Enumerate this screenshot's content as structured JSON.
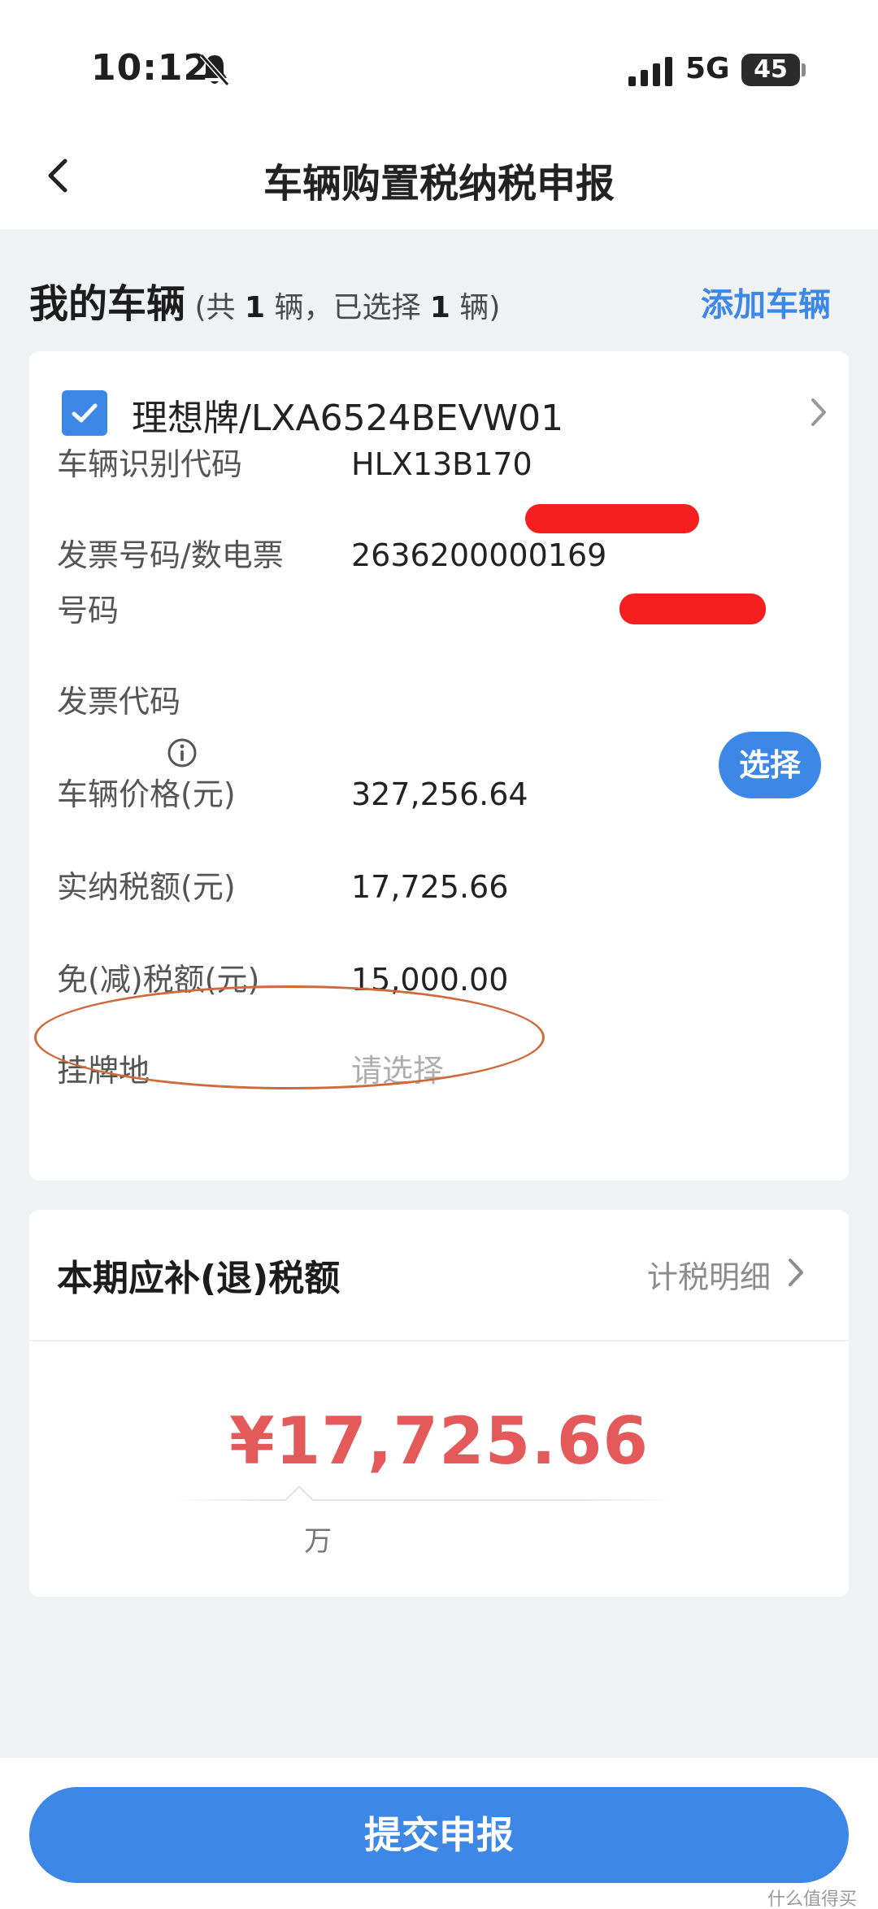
{
  "status_bar": {
    "time": "10:12",
    "network": "5G",
    "battery": "45"
  },
  "nav": {
    "title": "车辆购置税纳税申报"
  },
  "section": {
    "title": "我的车辆",
    "subtitle_pre": " (共 ",
    "total_count": "1",
    "subtitle_mid": " 辆，已选择 ",
    "selected_count": "1",
    "subtitle_post": " 辆)",
    "add_link": "添加车辆"
  },
  "vehicle": {
    "name": "理想牌/LXA6524BEVW01",
    "rows": [
      {
        "label": "车辆识别代码",
        "value": "HLX13B170"
      },
      {
        "label": "发票号码/数电票",
        "label2": "号码",
        "value": "2636200000169"
      },
      {
        "label": "发票代码",
        "value": ""
      },
      {
        "label": "车辆价格(元)",
        "value": "327,256.64"
      },
      {
        "label": "实纳税额(元)",
        "value": "17,725.66"
      },
      {
        "label": "免(减)税额(元)",
        "value": "15,000.00"
      },
      {
        "label": "挂牌地",
        "value": "请选择"
      }
    ],
    "select_button": "选择"
  },
  "tax": {
    "title": "本期应补(退)税额",
    "detail_link": "计税明细",
    "amount": "¥17,725.66",
    "unit": "万"
  },
  "footer": {
    "submit": "提交申报",
    "watermark": "什么值得买"
  },
  "colors": {
    "accent": "#3d87e6",
    "amount": "#e45a5a",
    "redaction": "#f51f1f",
    "annotation": "#cf6a3a"
  }
}
